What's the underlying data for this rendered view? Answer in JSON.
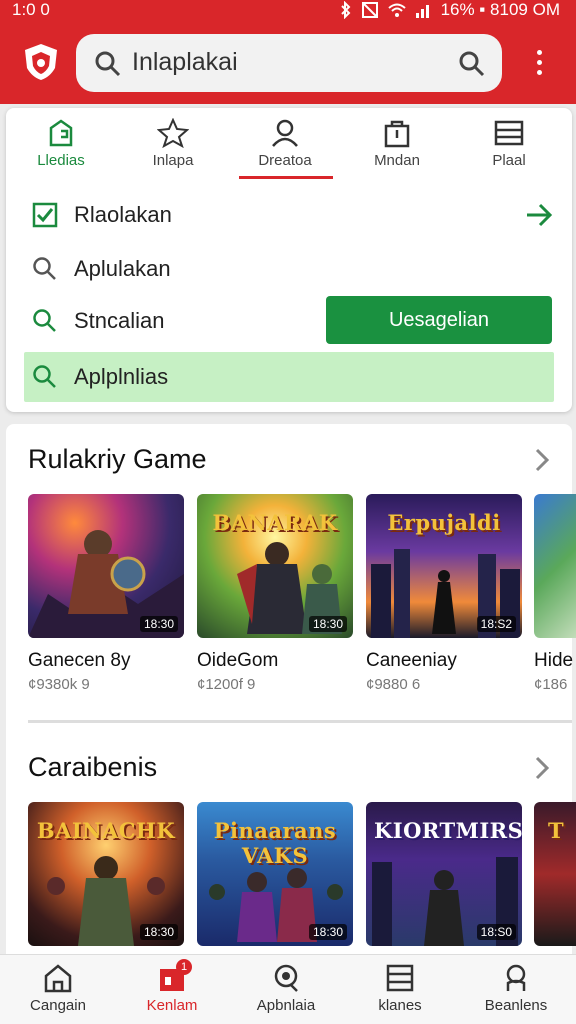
{
  "status": {
    "time": "1:0 0",
    "right_text": "16% ▪ 8109 OM"
  },
  "search": {
    "query": "Inlaplakai"
  },
  "tabs": [
    {
      "label": "Lledias",
      "icon": "home-icon"
    },
    {
      "label": "Inlapa",
      "icon": "star-icon"
    },
    {
      "label": "Dreatoa",
      "icon": "person-icon"
    },
    {
      "label": "Mndan",
      "icon": "bag-icon"
    },
    {
      "label": "Plaal",
      "icon": "list-icon"
    }
  ],
  "suggestions": [
    {
      "label": "Rlaolakan",
      "icon": "checkbox-icon"
    },
    {
      "label": "Aplulakan",
      "icon": "search-icon"
    },
    {
      "label": "Stncalian",
      "icon": "search-icon"
    },
    {
      "label": "Aplplnlias",
      "icon": "search-icon"
    }
  ],
  "green_button": {
    "label": "Uesagelian"
  },
  "sections": [
    {
      "title": "Rulakriy Game",
      "cards": [
        {
          "name": "Ganecen 8y",
          "sub": "¢9380k 9",
          "badge": "18:30"
        },
        {
          "name": "OideGom",
          "sub": "¢1200f 9",
          "badge": "18:30"
        },
        {
          "name": "Caneeniay",
          "sub": "¢9880 6",
          "badge": "18:S2"
        },
        {
          "name": "Hide",
          "sub": "¢186"
        }
      ],
      "logos": [
        "",
        "BANARAK",
        "Erpujaldi",
        ""
      ]
    },
    {
      "title": "Caraibenis",
      "cards": [
        {
          "badge": "18:30"
        },
        {
          "badge": "18:30"
        },
        {
          "badge": "18:S0"
        },
        {}
      ],
      "logos": [
        "BAINACHK",
        "Pinaarans VAKS",
        "KIORTMIRS",
        "T"
      ]
    }
  ],
  "bottom_nav": [
    {
      "label": "Cangain",
      "icon": "home-icon"
    },
    {
      "label": "Kenlam",
      "icon": "store-icon",
      "badge": "1"
    },
    {
      "label": "Apbnlaia",
      "icon": "search-icon"
    },
    {
      "label": "klanes",
      "icon": "list-icon"
    },
    {
      "label": "Beanlens",
      "icon": "person-icon"
    }
  ],
  "colors": {
    "brand_red": "#d9262a",
    "accent_green": "#1a9140",
    "highlight_green": "#c6f0c4"
  }
}
